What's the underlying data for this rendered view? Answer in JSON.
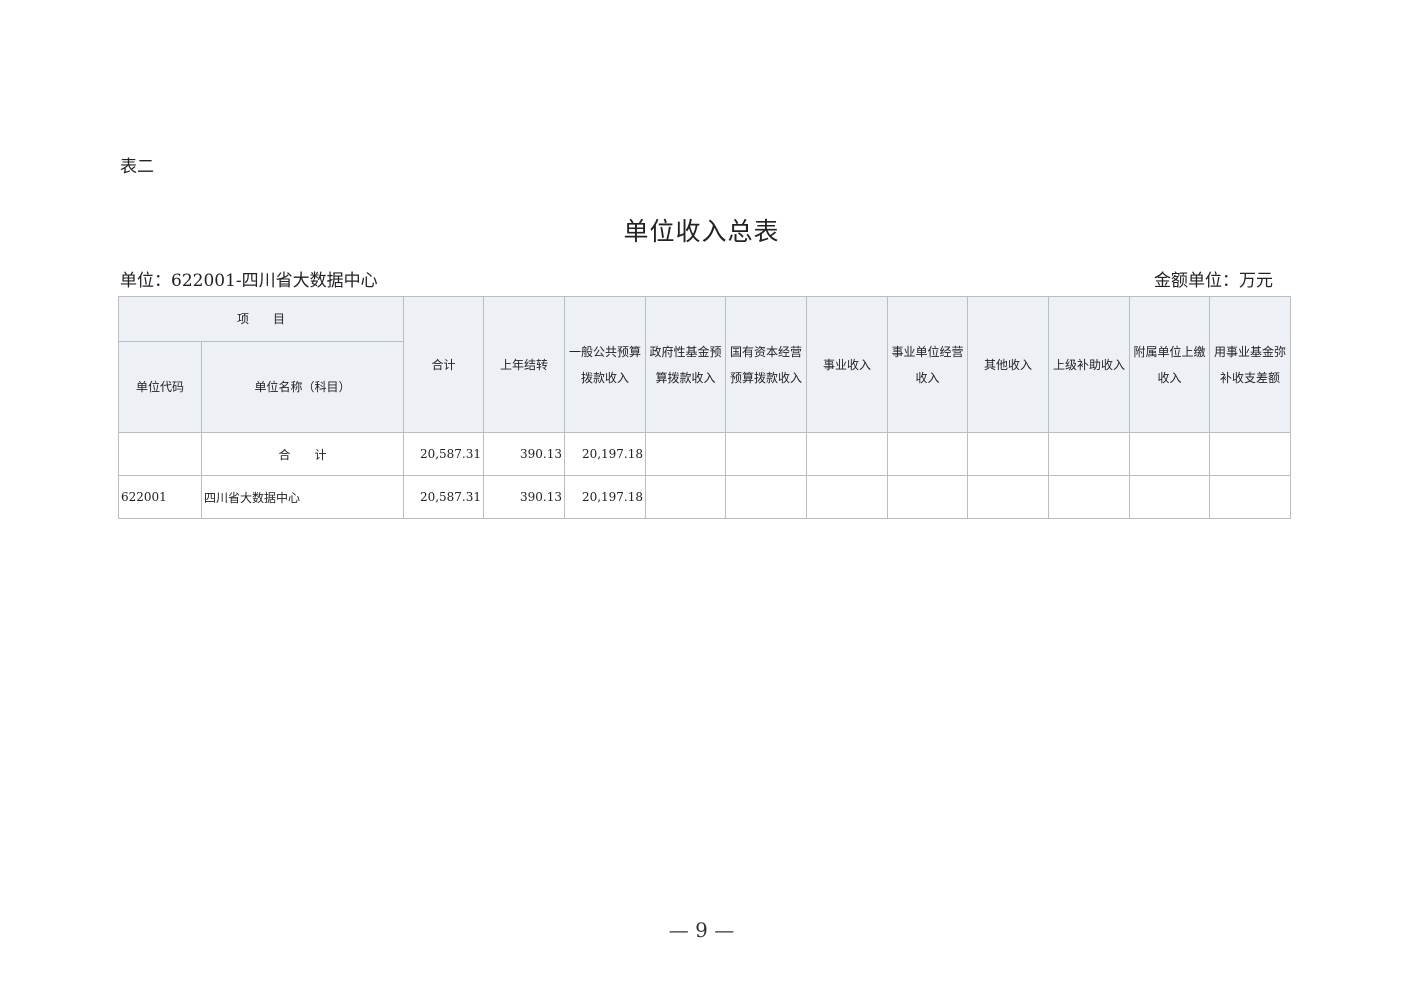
{
  "page": {
    "table_label": "表二",
    "title": "单位收入总表",
    "unit": "单位：622001-四川省大数据中心",
    "amount_unit": "金额单位：万元",
    "footer": "— 9 —"
  },
  "table": {
    "group_header": "项　　目",
    "code_header": "单位代码",
    "name_header": "单位名称（科目）",
    "value_headers": [
      "合计",
      "上年结转",
      "一般公共预算拨款收入",
      "政府性基金预算拨款收入",
      "国有资本经营预算拨款收入",
      "事业收入",
      "事业单位经营收入",
      "其他收入",
      "上级补助收入",
      "附属单位上缴收入",
      "用事业基金弥补收支差额"
    ],
    "rows": [
      {
        "code": "",
        "name": "合　　计",
        "values": [
          "20,587.31",
          "390.13",
          "20,197.18",
          "",
          "",
          "",
          "",
          "",
          "",
          "",
          ""
        ]
      },
      {
        "code": "622001",
        "name": "四川省大数据中心",
        "values": [
          "20,587.31",
          "390.13",
          "20,197.18",
          "",
          "",
          "",
          "",
          "",
          "",
          "",
          ""
        ]
      }
    ]
  }
}
